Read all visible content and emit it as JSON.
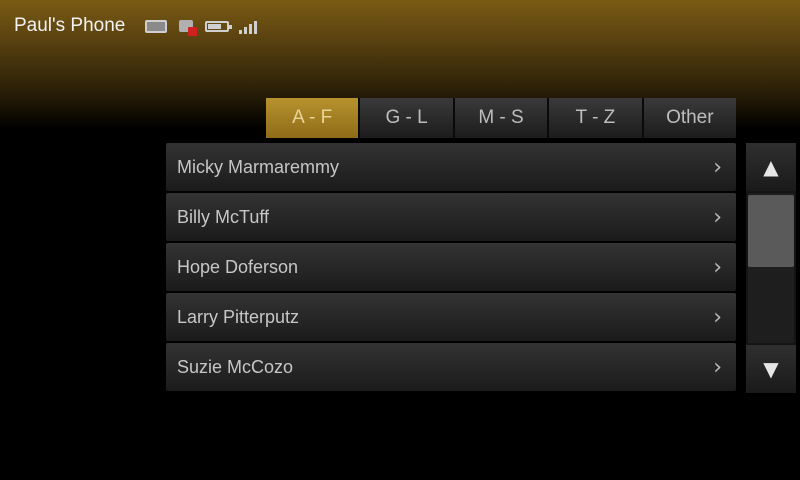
{
  "status": {
    "phone_name": "Paul's Phone",
    "icons": [
      "sms-icon",
      "voicemail-icon",
      "battery-icon",
      "signal-icon"
    ],
    "battery_level": 0.7,
    "signal_bars": 4
  },
  "tabs": [
    {
      "label": "A - F",
      "active": true
    },
    {
      "label": "G - L",
      "active": false
    },
    {
      "label": "M - S",
      "active": false
    },
    {
      "label": "T - Z",
      "active": false
    },
    {
      "label": "Other",
      "active": false
    }
  ],
  "contacts": [
    {
      "name": "Micky Marmaremmy"
    },
    {
      "name": "Billy McTuff"
    },
    {
      "name": "Hope Doferson"
    },
    {
      "name": "Larry Pitterputz"
    },
    {
      "name": "Suzie McCozo"
    }
  ],
  "scroll": {
    "up_glyph": "▲",
    "down_glyph": "▼",
    "chevron_glyph": "›"
  },
  "colors": {
    "accent": "#b8922e",
    "background": "#000000"
  }
}
